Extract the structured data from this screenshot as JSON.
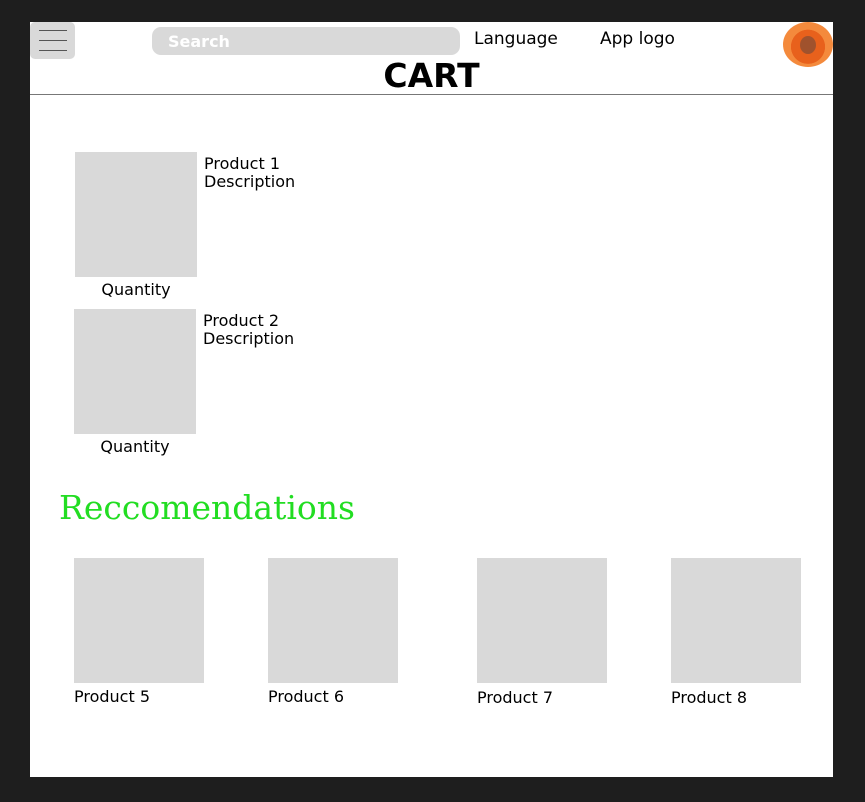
{
  "header": {
    "search_placeholder": "Search",
    "language_label": "Language",
    "app_logo_label": "App logo",
    "menu_icon": "hamburger-icon",
    "avatar_icon": "user-avatar"
  },
  "page": {
    "title": "CART"
  },
  "cart": {
    "items": [
      {
        "name": "Product 1",
        "description": "Description",
        "quantity_label": "Quantity"
      },
      {
        "name": "Product 2",
        "description": "Description",
        "quantity_label": "Quantity"
      }
    ]
  },
  "recommendations": {
    "title": "Reccomendations",
    "title_color": "#22dd22",
    "items": [
      {
        "name": "Product 5"
      },
      {
        "name": "Product 6"
      },
      {
        "name": "Product 7"
      },
      {
        "name": "Product 8"
      }
    ]
  }
}
